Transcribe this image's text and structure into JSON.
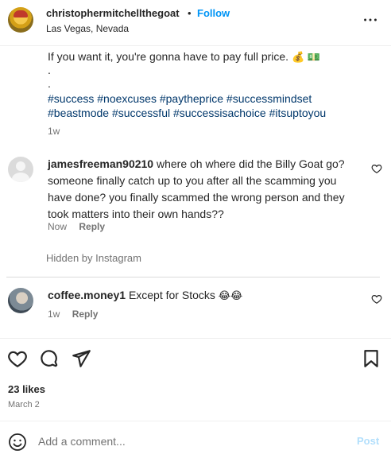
{
  "header": {
    "username": "christophermitchellthegoat",
    "separator": "•",
    "follow_label": "Follow",
    "location": "Las Vegas, Nevada",
    "more_icon": "more-horizontal-icon"
  },
  "caption": {
    "text": "If you want it, you're gonna have to pay full price.",
    "emojis": "💰 💵",
    "dot1": ".",
    "dot2": ".",
    "hashtags_line1": "#success #noexcuses #paytheprice #successmindset",
    "hashtags_line2": "#beastmode #successful #successisachoice #itsuptoyou",
    "time": "1w"
  },
  "comments": [
    {
      "username": "jamesfreeman90210",
      "text": "where oh where did the Billy Goat go? someone finally catch up to you after all the scamming you have done? you finally scammed the wrong person and they took matters into their own hands??",
      "time": "Now",
      "reply_label": "Reply"
    },
    {
      "username": "coffee.money1",
      "text": "Except for Stocks",
      "emojis": "😂😂",
      "time": "1w",
      "reply_label": "Reply"
    }
  ],
  "hidden_notice": "Hidden by Instagram",
  "actions": {
    "likes": "23 likes",
    "date": "March 2"
  },
  "comment_box": {
    "placeholder": "Add a comment...",
    "post_label": "Post"
  },
  "colors": {
    "accent": "#0095f6",
    "hashtag": "#00376b",
    "muted": "#737373",
    "post_disabled": "#b2dffc"
  }
}
